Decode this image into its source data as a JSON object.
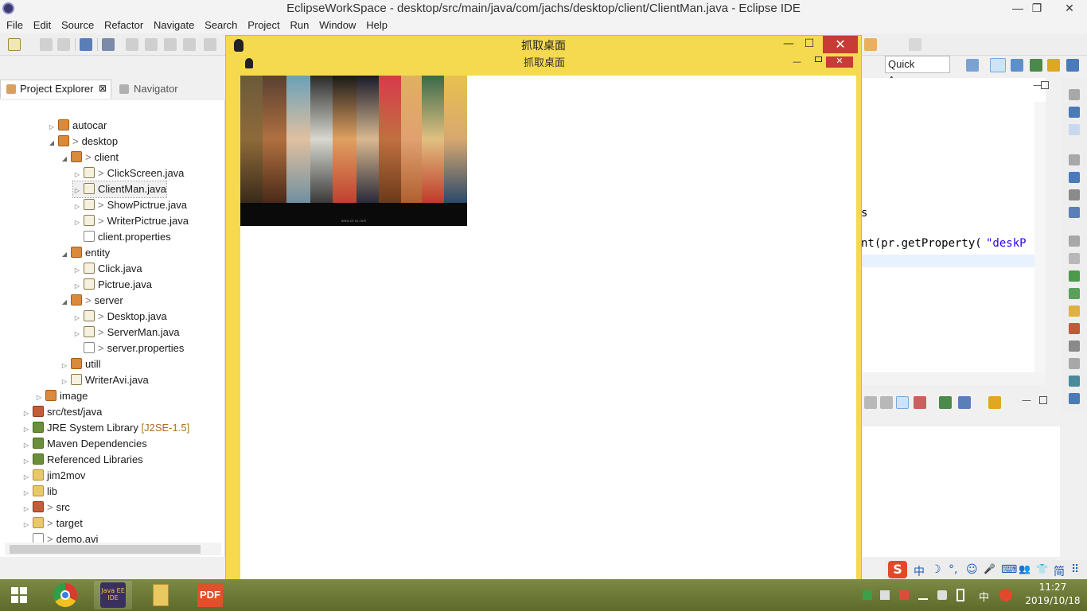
{
  "eclipse": {
    "title": "EclipseWorkSpace - desktop/src/main/java/com/jachs/desktop/client/ClientMan.java - Eclipse IDE",
    "window_buttons": {
      "minimize": "—",
      "maximize": "❐",
      "close": "✕"
    },
    "menu": [
      "File",
      "Edit",
      "Source",
      "Refactor",
      "Navigate",
      "Search",
      "Project",
      "Run",
      "Window",
      "Help"
    ],
    "quick_access": "Quick Access"
  },
  "project_explorer": {
    "tab_label": "Project Explorer",
    "tab_close": "⊠",
    "navigator_label": "Navigator",
    "tree": [
      {
        "label": "autocar",
        "icon": "package-icon",
        "twisty": "▷",
        "deco": ""
      },
      {
        "label": "desktop",
        "icon": "package-icon",
        "twisty": "◢",
        "deco": ">"
      },
      {
        "label": "client",
        "icon": "package-icon",
        "twisty": "◢",
        "deco": ">"
      },
      {
        "label": "ClickScreen.java",
        "icon": "java-file-icon",
        "twisty": "▷",
        "deco": ">"
      },
      {
        "label": "ClientMan.java",
        "icon": "java-file-icon",
        "twisty": "▷",
        "deco": ""
      },
      {
        "label": "ShowPictrue.java",
        "icon": "java-file-icon",
        "twisty": "▷",
        "deco": ">"
      },
      {
        "label": "WriterPictrue.java",
        "icon": "java-file-icon",
        "twisty": "▷",
        "deco": ">"
      },
      {
        "label": "client.properties",
        "icon": "properties-file-icon",
        "twisty": "",
        "deco": ""
      },
      {
        "label": "entity",
        "icon": "package-icon",
        "twisty": "◢",
        "deco": ""
      },
      {
        "label": "Click.java",
        "icon": "java-file-icon",
        "twisty": "▷",
        "deco": ""
      },
      {
        "label": "Pictrue.java",
        "icon": "java-file-icon",
        "twisty": "▷",
        "deco": ""
      },
      {
        "label": "server",
        "icon": "package-icon",
        "twisty": "◢",
        "deco": ">"
      },
      {
        "label": "Desktop.java",
        "icon": "java-file-icon",
        "twisty": "▷",
        "deco": ">"
      },
      {
        "label": "ServerMan.java",
        "icon": "java-file-icon",
        "twisty": "▷",
        "deco": ">"
      },
      {
        "label": "server.properties",
        "icon": "properties-file-icon",
        "twisty": "",
        "deco": ">"
      },
      {
        "label": "utill",
        "icon": "package-icon",
        "twisty": "▷",
        "deco": ""
      },
      {
        "label": "WriterAvi.java",
        "icon": "java-file-icon",
        "twisty": "▷",
        "deco": ""
      },
      {
        "label": "image",
        "icon": "package-icon",
        "twisty": "▷",
        "deco": ""
      },
      {
        "label": "src/test/java",
        "icon": "source-folder-icon",
        "twisty": "▷",
        "deco": ""
      },
      {
        "label": "JRE System Library",
        "icon": "library-icon",
        "twisty": "▷",
        "deco": "",
        "suffix": "[J2SE-1.5]"
      },
      {
        "label": "Maven Dependencies",
        "icon": "library-icon",
        "twisty": "▷",
        "deco": ""
      },
      {
        "label": "Referenced Libraries",
        "icon": "library-icon",
        "twisty": "▷",
        "deco": ""
      },
      {
        "label": "jim2mov",
        "icon": "folder-icon",
        "twisty": "▷",
        "deco": ""
      },
      {
        "label": "lib",
        "icon": "folder-icon",
        "twisty": "▷",
        "deco": ""
      },
      {
        "label": "src",
        "icon": "source-folder-icon",
        "twisty": "▷",
        "deco": ">"
      },
      {
        "label": "target",
        "icon": "folder-icon",
        "twisty": "▷",
        "deco": ">"
      },
      {
        "label": "demo.avi",
        "icon": "file-icon",
        "twisty": "",
        "deco": ">"
      }
    ]
  },
  "editor": {
    "line1": "s",
    "line2_a": "nt(pr.getProperty(",
    "line2_b": "\"deskP"
  },
  "grab_window": {
    "title": "抓取桌面",
    "inner_title": "抓取桌面",
    "close": "✕",
    "minimize": "—",
    "maximize": "☐",
    "screenshot_caption": "www.xx-xx.com"
  },
  "ime": {
    "items": [
      "中",
      "☽",
      "°,",
      "☺",
      "🎤",
      "⌨",
      "👥",
      "👕",
      "简",
      "⠿"
    ]
  },
  "taskbar": {
    "apps": [
      "windows-start",
      "chrome",
      "java-ee-ide",
      "file-explorer",
      "pdf"
    ],
    "java_ee_label": "Java EE IDE",
    "pdf_label": "PDF",
    "clock_time": "11:27",
    "clock_date": "2019/10/18",
    "tray_lang": "中"
  },
  "colors": {
    "frame_yellow": "#f5da4f",
    "close_red": "#c83c35",
    "eclipse_bg": "#f0f0f0",
    "selection_blue": "#cfe3f7"
  }
}
